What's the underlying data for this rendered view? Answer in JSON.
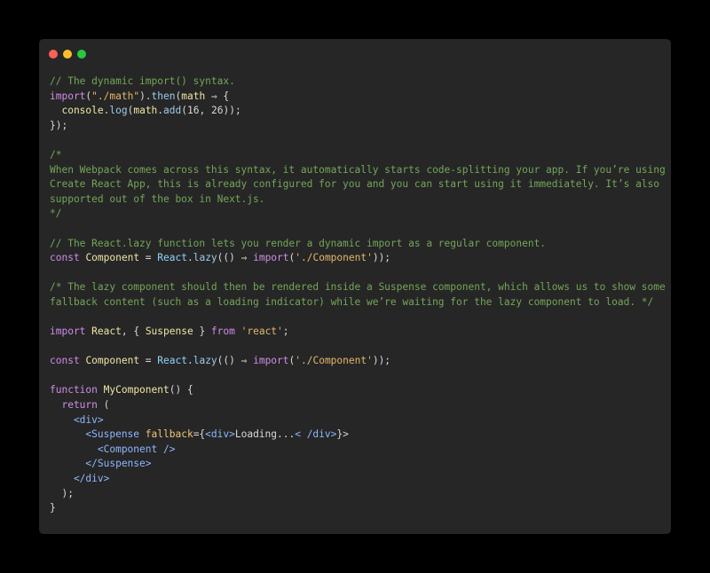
{
  "window": {
    "buttons": [
      "close",
      "minimize",
      "zoom"
    ]
  },
  "code": {
    "lines": [
      [
        {
          "t": "// The dynamic import() syntax.",
          "c": "comment"
        }
      ],
      [
        {
          "t": "import",
          "c": "keyword"
        },
        {
          "t": "(",
          "c": "punct"
        },
        {
          "t": "\"./math\"",
          "c": "string"
        },
        {
          "t": ").",
          "c": "punct"
        },
        {
          "t": "then",
          "c": "func"
        },
        {
          "t": "(",
          "c": "punct"
        },
        {
          "t": "math",
          "c": "ident"
        },
        {
          "t": " ⇒ {",
          "c": "punct"
        }
      ],
      [
        {
          "t": "  console",
          "c": "ident"
        },
        {
          "t": ".",
          "c": "punct"
        },
        {
          "t": "log",
          "c": "func"
        },
        {
          "t": "(",
          "c": "punct"
        },
        {
          "t": "math",
          "c": "ident"
        },
        {
          "t": ".",
          "c": "punct"
        },
        {
          "t": "add",
          "c": "func"
        },
        {
          "t": "(",
          "c": "punct"
        },
        {
          "t": "16",
          "c": "num"
        },
        {
          "t": ", ",
          "c": "punct"
        },
        {
          "t": "26",
          "c": "num"
        },
        {
          "t": "));",
          "c": "punct"
        }
      ],
      [
        {
          "t": "});",
          "c": "punct"
        }
      ],
      [],
      [
        {
          "t": "/*",
          "c": "comment"
        }
      ],
      [
        {
          "t": "When Webpack comes across this syntax, it automatically starts code-splitting your app. If you’re using",
          "c": "comment"
        }
      ],
      [
        {
          "t": "Create React App, this is already configured for you and you can start using it immediately. It’s also",
          "c": "comment"
        }
      ],
      [
        {
          "t": "supported out of the box in Next.js.",
          "c": "comment"
        }
      ],
      [
        {
          "t": "*/",
          "c": "comment"
        }
      ],
      [],
      [
        {
          "t": "// The React.lazy function lets you render a dynamic import as a regular component.",
          "c": "comment"
        }
      ],
      [
        {
          "t": "const",
          "c": "keyword"
        },
        {
          "t": " ",
          "c": "punct"
        },
        {
          "t": "Component",
          "c": "ident"
        },
        {
          "t": " = ",
          "c": "punct"
        },
        {
          "t": "React",
          "c": "react"
        },
        {
          "t": ".",
          "c": "punct"
        },
        {
          "t": "lazy",
          "c": "func"
        },
        {
          "t": "(() ⇒ ",
          "c": "punct"
        },
        {
          "t": "import",
          "c": "keyword"
        },
        {
          "t": "(",
          "c": "punct"
        },
        {
          "t": "'./Component'",
          "c": "string"
        },
        {
          "t": "));",
          "c": "punct"
        }
      ],
      [],
      [
        {
          "t": "/* The lazy component should then be rendered inside a Suspense component, which allows us to show some",
          "c": "comment"
        }
      ],
      [
        {
          "t": "fallback content (such as a loading indicator) while we’re waiting for the lazy component to load. */",
          "c": "comment"
        }
      ],
      [],
      [
        {
          "t": "import",
          "c": "keyword"
        },
        {
          "t": " ",
          "c": "punct"
        },
        {
          "t": "React",
          "c": "ident"
        },
        {
          "t": ", { ",
          "c": "punct"
        },
        {
          "t": "Suspense",
          "c": "ident"
        },
        {
          "t": " } ",
          "c": "punct"
        },
        {
          "t": "from",
          "c": "keyword"
        },
        {
          "t": " ",
          "c": "punct"
        },
        {
          "t": "'react'",
          "c": "string"
        },
        {
          "t": ";",
          "c": "punct"
        }
      ],
      [],
      [
        {
          "t": "const",
          "c": "keyword"
        },
        {
          "t": " ",
          "c": "punct"
        },
        {
          "t": "Component",
          "c": "ident"
        },
        {
          "t": " = ",
          "c": "punct"
        },
        {
          "t": "React",
          "c": "react"
        },
        {
          "t": ".",
          "c": "punct"
        },
        {
          "t": "lazy",
          "c": "func"
        },
        {
          "t": "(() ⇒ ",
          "c": "punct"
        },
        {
          "t": "import",
          "c": "keyword"
        },
        {
          "t": "(",
          "c": "punct"
        },
        {
          "t": "'./Component'",
          "c": "string"
        },
        {
          "t": "));",
          "c": "punct"
        }
      ],
      [],
      [
        {
          "t": "function",
          "c": "keyword"
        },
        {
          "t": " ",
          "c": "punct"
        },
        {
          "t": "MyComponent",
          "c": "ident"
        },
        {
          "t": "() {",
          "c": "punct"
        }
      ],
      [
        {
          "t": "  return",
          "c": "keyword"
        },
        {
          "t": " (",
          "c": "punct"
        }
      ],
      [
        {
          "t": "    <div>",
          "c": "tag"
        }
      ],
      [
        {
          "t": "      <Suspense",
          "c": "tag"
        },
        {
          "t": " ",
          "c": "punct"
        },
        {
          "t": "fallback",
          "c": "attr"
        },
        {
          "t": "={",
          "c": "punct"
        },
        {
          "t": "<div>",
          "c": "tag"
        },
        {
          "t": "Loading...",
          "c": "punct"
        },
        {
          "t": "< /div>",
          "c": "tag"
        },
        {
          "t": "}>",
          "c": "punct"
        }
      ],
      [
        {
          "t": "        <Component />",
          "c": "tag"
        }
      ],
      [
        {
          "t": "      </Suspense>",
          "c": "tag"
        }
      ],
      [
        {
          "t": "    </div>",
          "c": "tag"
        }
      ],
      [
        {
          "t": "  );",
          "c": "punct"
        }
      ],
      [
        {
          "t": "}",
          "c": "punct"
        }
      ]
    ]
  }
}
